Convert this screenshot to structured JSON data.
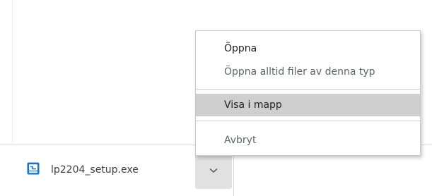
{
  "download": {
    "file_name": "lp2204_setup.exe",
    "icon": "installer-file-icon",
    "menu_button_icon": "chevron-down-icon"
  },
  "context_menu": {
    "items": [
      {
        "label": "Öppna"
      },
      {
        "label": "Öppna alltid filer av denna typ"
      },
      {
        "label": "Visa i mapp"
      },
      {
        "label": "Avbryt"
      }
    ]
  },
  "colors": {
    "hover_background": "#cfcfcf",
    "icon_accent": "#1a73c9",
    "menu_button_background": "#e1e1e1"
  }
}
